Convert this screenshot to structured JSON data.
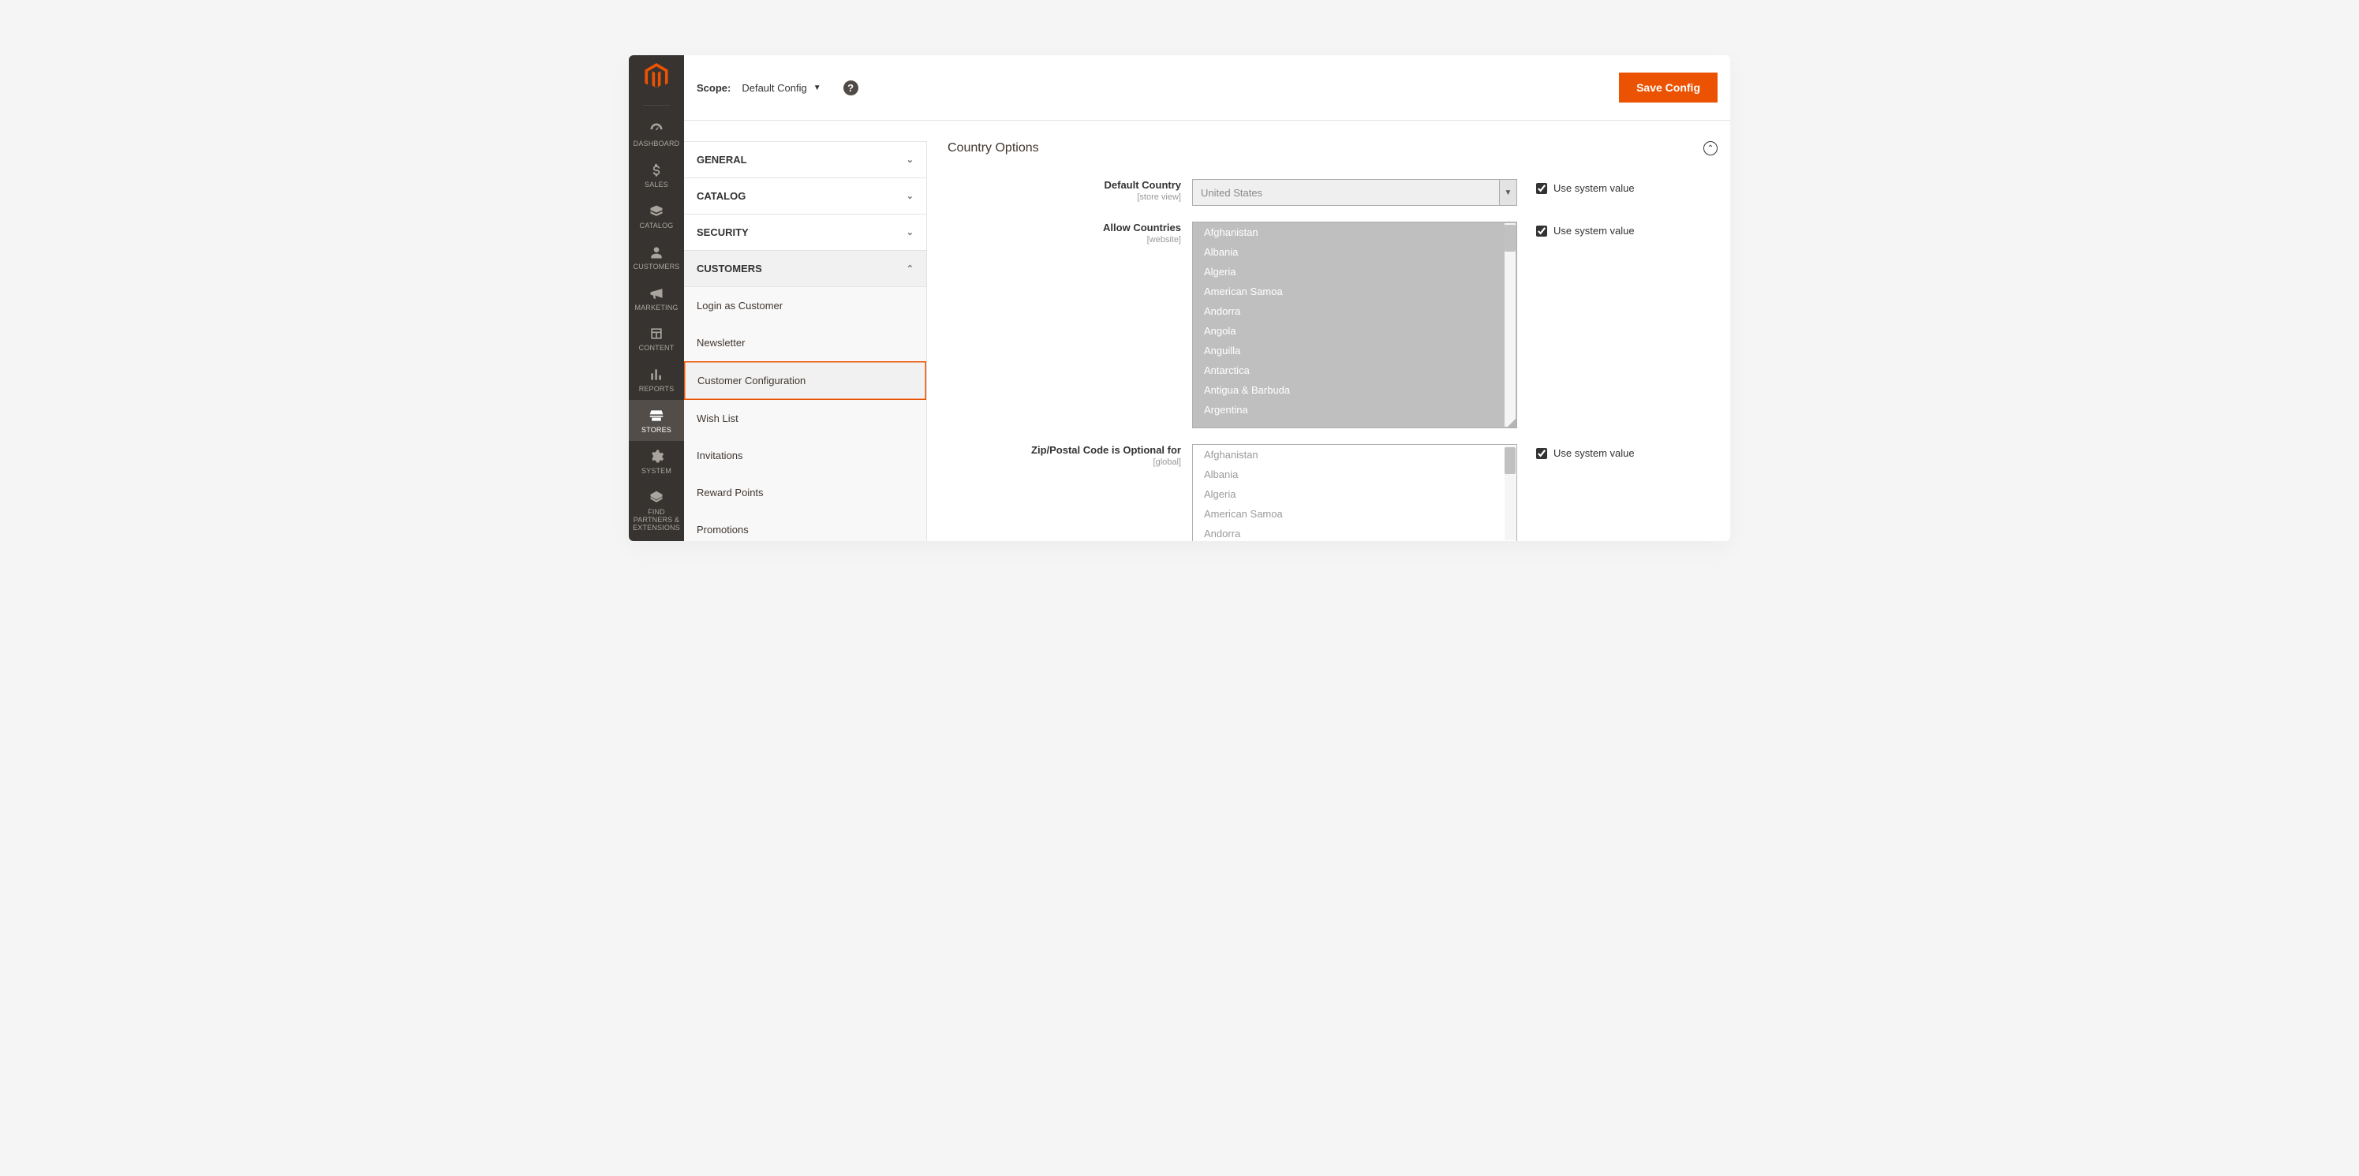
{
  "header": {
    "scope_label": "Scope:",
    "scope_value": "Default Config",
    "save_label": "Save Config"
  },
  "sidebar": {
    "items": [
      {
        "id": "dashboard",
        "label": "DASHBOARD"
      },
      {
        "id": "sales",
        "label": "SALES"
      },
      {
        "id": "catalog",
        "label": "CATALOG"
      },
      {
        "id": "customers",
        "label": "CUSTOMERS"
      },
      {
        "id": "marketing",
        "label": "MARKETING"
      },
      {
        "id": "content",
        "label": "CONTENT"
      },
      {
        "id": "reports",
        "label": "REPORTS"
      },
      {
        "id": "stores",
        "label": "STORES"
      },
      {
        "id": "system",
        "label": "SYSTEM"
      },
      {
        "id": "partners",
        "label": "FIND PARTNERS & EXTENSIONS"
      }
    ]
  },
  "tabs": [
    {
      "id": "general",
      "label": "GENERAL",
      "open": false
    },
    {
      "id": "catalog",
      "label": "CATALOG",
      "open": false
    },
    {
      "id": "security",
      "label": "SECURITY",
      "open": false
    },
    {
      "id": "customers",
      "label": "CUSTOMERS",
      "open": true,
      "items": [
        {
          "id": "login_as_customer",
          "label": "Login as Customer"
        },
        {
          "id": "newsletter",
          "label": "Newsletter"
        },
        {
          "id": "customer_configuration",
          "label": "Customer Configuration",
          "active": true
        },
        {
          "id": "wish_list",
          "label": "Wish List"
        },
        {
          "id": "invitations",
          "label": "Invitations"
        },
        {
          "id": "reward_points",
          "label": "Reward Points"
        },
        {
          "id": "promotions",
          "label": "Promotions"
        }
      ]
    }
  ],
  "section": {
    "title": "Country Options",
    "use_system_value_label": "Use system value",
    "fields": {
      "default_country": {
        "label": "Default Country",
        "scope": "[store view]",
        "value": "United States",
        "use_system": true
      },
      "allow_countries": {
        "label": "Allow Countries",
        "scope": "[website]",
        "use_system": true,
        "options": [
          "Afghanistan",
          "Albania",
          "Algeria",
          "American Samoa",
          "Andorra",
          "Angola",
          "Anguilla",
          "Antarctica",
          "Antigua & Barbuda",
          "Argentina"
        ]
      },
      "zip_optional": {
        "label": "Zip/Postal Code is Optional for",
        "scope": "[global]",
        "use_system": true,
        "options": [
          "Afghanistan",
          "Albania",
          "Algeria",
          "American Samoa",
          "Andorra"
        ]
      }
    }
  }
}
